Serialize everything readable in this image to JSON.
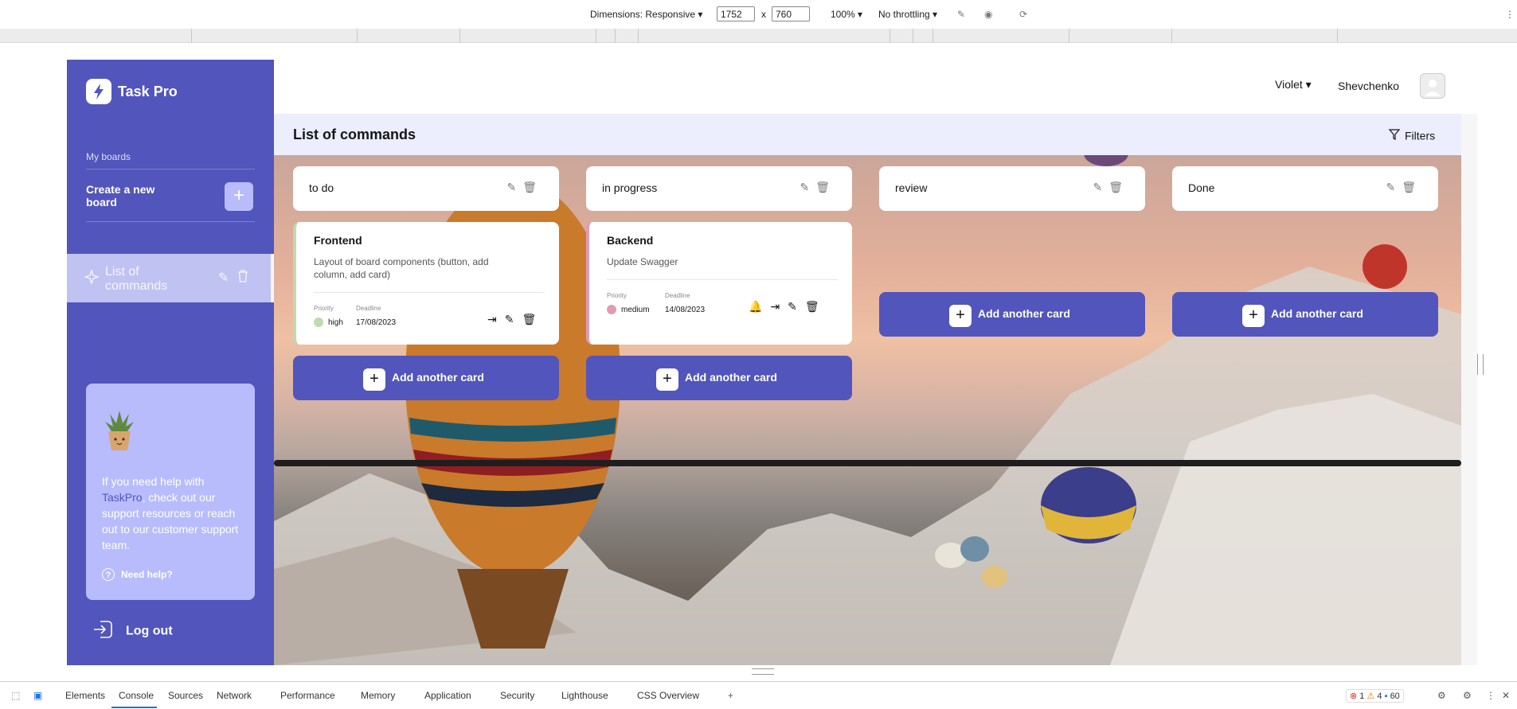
{
  "devtools": {
    "dimensions_label": "Dimensions: Responsive",
    "width_value": "1752",
    "times": "x",
    "height_value": "760",
    "zoom": "100%",
    "throttling": "No throttling",
    "tabs": [
      "Elements",
      "Console",
      "Sources",
      "Network",
      "Performance",
      "Memory",
      "Application",
      "Security",
      "Lighthouse",
      "CSS Overview"
    ],
    "errors": "1",
    "warnings": "4",
    "messages": "60"
  },
  "sidebar": {
    "app_name": "Task Pro",
    "my_boards": "My boards",
    "create_board": "Create a new board",
    "create_plus": "+",
    "board_item": "List of commands",
    "help_text_1": "If you need help with ",
    "help_brand": "TaskPro",
    "help_text_2": ", check out our support resources or reach out to our customer support team.",
    "need_help": "Need help?",
    "logout": "Log out"
  },
  "header": {
    "theme": "Violet",
    "user_name": "Shevchenko"
  },
  "board": {
    "title": "List of commands",
    "filters": "Filters",
    "columns": [
      {
        "title": "to do"
      },
      {
        "title": "in progress"
      },
      {
        "title": "review"
      },
      {
        "title": "Done"
      }
    ],
    "cards": [
      {
        "title": "Frontend",
        "description": "Layout of board components (button, add column, add card)",
        "priority_label": "Priority",
        "priority": "high",
        "deadline_label": "Deadline",
        "deadline": "17/08/2023",
        "priority_color": "#bedbb0"
      },
      {
        "title": "Backend",
        "description": "Update Swagger",
        "priority_label": "Priority",
        "priority": "medium",
        "deadline_label": "Deadline",
        "deadline": "14/08/2023",
        "priority_color": "#e09cb5"
      }
    ],
    "add_card": "Add another card"
  },
  "colors": {
    "accent": "#5255bc",
    "accent_light": "#b8bcfd",
    "bell_red": "#e53935"
  }
}
